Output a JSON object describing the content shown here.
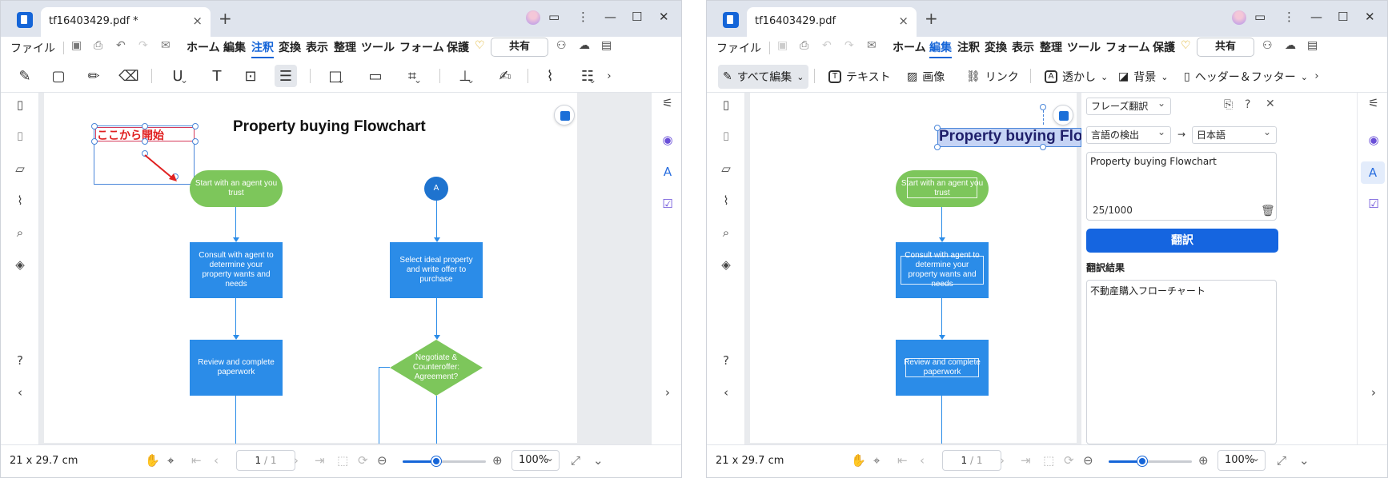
{
  "left": {
    "tab_title": "tf16403429.pdf *",
    "menu": {
      "file": "ファイル",
      "items": [
        "ホーム",
        "編集",
        "注釈",
        "変換",
        "表示",
        "整理",
        "ツール",
        "フォーム",
        "保護"
      ],
      "active": "注釈",
      "share": "共有"
    },
    "annotation_text": "ここから開始",
    "flowchart": {
      "title": "Property buying Flowchart",
      "nodes": {
        "start": "Start with an agent you trust",
        "consult": "Consult with agent to determine your property wants and needs",
        "review": "Review and complete paperwork",
        "connector": "A",
        "select": "Select ideal property and write offer to purchase",
        "negotiate": "Negotiate & Counteroffer: Agreement?"
      }
    }
  },
  "right": {
    "tab_title": "tf16403429.pdf",
    "menu": {
      "file": "ファイル",
      "items": [
        "ホーム",
        "編集",
        "注釈",
        "変換",
        "表示",
        "整理",
        "ツール",
        "フォーム",
        "保護"
      ],
      "active": "編集",
      "share": "共有"
    },
    "edit_toolbar": {
      "edit_all": "すべて編集",
      "text": "テキスト",
      "image": "画像",
      "link": "リンク",
      "watermark": "透かし",
      "background": "背景",
      "header_footer": "ヘッダー＆フッター"
    },
    "flowchart": {
      "title_visible": "Property buying Flo",
      "nodes": {
        "start": "Start with an agent you trust",
        "consult": "Consult with agent to determine your property wants and needs",
        "review": "Review and complete paperwork"
      }
    },
    "translate_panel": {
      "mode": "フレーズ翻訳",
      "source_lang": "言語の検出",
      "arrow": "→",
      "target_lang": "日本語",
      "source_text": "Property buying Flowchart",
      "char_count": "25/1000",
      "translate_button": "翻訳",
      "result_label": "翻訳結果",
      "result_text": "不動産購入フローチャート"
    }
  },
  "status": {
    "page_size": "21 x 29.7 cm",
    "page_current": "1",
    "page_total": "/ 1",
    "zoom": "100%",
    "zoom_level": 0.4
  },
  "icons": {
    "window_controls": [
      "minimize-icon",
      "maximize-icon",
      "close-icon"
    ],
    "left_rail": [
      "page-icon",
      "bookmark-icon",
      "comment-icon",
      "attachment-icon",
      "search-icon",
      "layers-icon",
      "help-icon",
      "collapse-icon"
    ],
    "right_rail": [
      "properties-icon",
      "ai-assistant-icon",
      "translate-icon",
      "check-icon",
      "expand-icon"
    ]
  },
  "colors": {
    "accent": "#1565d8",
    "flow_green": "#7dc65b",
    "flow_blue": "#2b8ce8",
    "annotation_red": "#e02020"
  }
}
